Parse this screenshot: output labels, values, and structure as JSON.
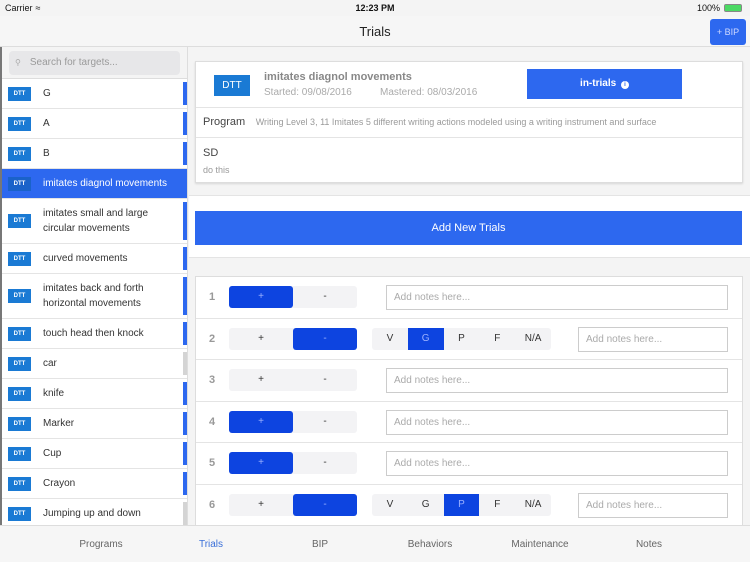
{
  "status_bar": {
    "carrier": "Carrier",
    "time": "12:23 PM",
    "battery": "100%"
  },
  "nav": {
    "title": "Trials",
    "bip_button": "+ BIP"
  },
  "sidebar": {
    "search_placeholder": "Search for targets...",
    "targets": [
      {
        "badge": "DTT",
        "label": "G",
        "indicator": "blue"
      },
      {
        "badge": "DTT",
        "label": "A",
        "indicator": "blue"
      },
      {
        "badge": "DTT",
        "label": "B",
        "indicator": "blue"
      },
      {
        "badge": "DTT",
        "label": "imitates diagnol movements",
        "selected": true
      },
      {
        "badge": "DTT",
        "label": "imitates small and large circular movements",
        "indicator": "blue"
      },
      {
        "badge": "DTT",
        "label": "curved movements",
        "indicator": "blue"
      },
      {
        "badge": "DTT",
        "label": "imitates back and forth horizontal movements",
        "indicator": "blue"
      },
      {
        "badge": "DTT",
        "label": "touch head then knock",
        "indicator": "blue"
      },
      {
        "badge": "DTT",
        "label": "car",
        "indicator": "gray"
      },
      {
        "badge": "DTT",
        "label": "knife",
        "indicator": "blue"
      },
      {
        "badge": "DTT",
        "label": "Marker",
        "indicator": "blue"
      },
      {
        "badge": "DTT",
        "label": "Cup",
        "indicator": "blue"
      },
      {
        "badge": "DTT",
        "label": "Crayon",
        "indicator": "blue"
      },
      {
        "badge": "DTT",
        "label": "Jumping up and down",
        "indicator": "gray"
      }
    ]
  },
  "detail": {
    "badge": "DTT",
    "name": "imitates diagnol movements",
    "started": "Started: 09/08/2016",
    "mastered": "Mastered: 08/03/2016",
    "status": "in-trials",
    "info_icon": "i",
    "program_label": "Program",
    "program_value": "Writing Level 3, 11 Imitates 5 different writing actions modeled using a writing instrument and surface",
    "sd_label": "SD",
    "sd_value": "do this"
  },
  "add_trials_button": "Add New Trials",
  "trials": {
    "plus": "+",
    "minus": "-",
    "prompt_options": [
      "V",
      "G",
      "P",
      "F",
      "N/A"
    ],
    "notes_placeholder": "Add notes here...",
    "rows": [
      {
        "num": "1",
        "result": "+"
      },
      {
        "num": "2",
        "result": "-",
        "prompt": "G"
      },
      {
        "num": "3",
        "result": ""
      },
      {
        "num": "4",
        "result": "+"
      },
      {
        "num": "5",
        "result": "+"
      },
      {
        "num": "6",
        "result": "-",
        "prompt": "P"
      }
    ]
  },
  "tabs": [
    {
      "label": "Programs"
    },
    {
      "label": "Trials",
      "active": true
    },
    {
      "label": "BIP"
    },
    {
      "label": "Behaviors"
    },
    {
      "label": "Maintenance"
    },
    {
      "label": "Notes"
    }
  ],
  "colors": {
    "accent": "#2d68ef",
    "selected_toggle": "#0d44e0",
    "badge": "#1a7ad4"
  }
}
